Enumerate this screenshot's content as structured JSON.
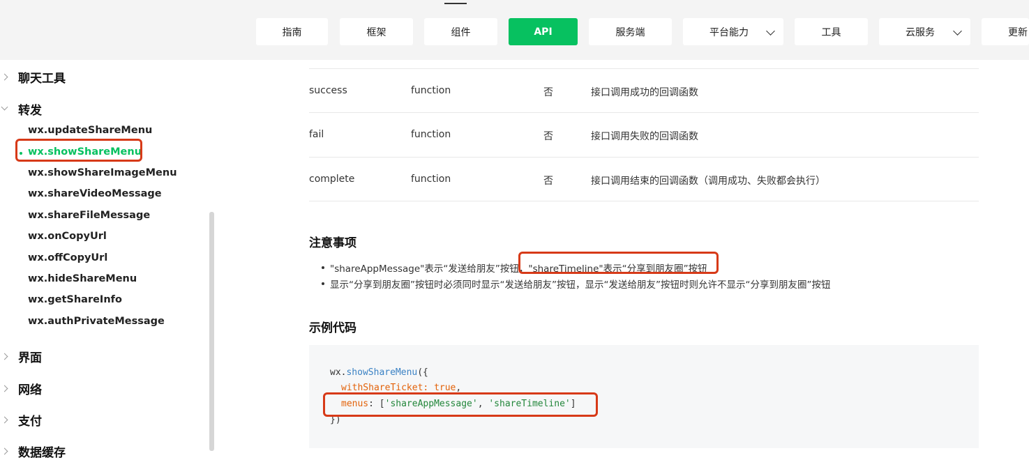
{
  "nav": {
    "tabs": [
      {
        "label": "指南"
      },
      {
        "label": "框架"
      },
      {
        "label": "组件"
      },
      {
        "label": "API"
      },
      {
        "label": "服务端"
      },
      {
        "label": "平台能力"
      },
      {
        "label": "工具"
      },
      {
        "label": "云服务"
      },
      {
        "label": "更新"
      }
    ],
    "active_color": "#07c160"
  },
  "sidebar": {
    "categories": [
      {
        "label": "聊天工具"
      },
      {
        "label": "转发"
      },
      {
        "label": "界面"
      },
      {
        "label": "网络"
      },
      {
        "label": "支付"
      },
      {
        "label": "数据缓存"
      }
    ],
    "items": [
      {
        "label": "wx.updateShareMenu"
      },
      {
        "label": "wx.showShareMenu"
      },
      {
        "label": "wx.showShareImageMenu"
      },
      {
        "label": "wx.shareVideoMessage"
      },
      {
        "label": "wx.shareFileMessage"
      },
      {
        "label": "wx.onCopyUrl"
      },
      {
        "label": "wx.offCopyUrl"
      },
      {
        "label": "wx.hideShareMenu"
      },
      {
        "label": "wx.getShareInfo"
      },
      {
        "label": "wx.authPrivateMessage"
      }
    ]
  },
  "params_table": {
    "rows": [
      {
        "name": "success",
        "type": "function",
        "required": "否",
        "desc": "接口调用成功的回调函数"
      },
      {
        "name": "fail",
        "type": "function",
        "required": "否",
        "desc": "接口调用失败的回调函数"
      },
      {
        "name": "complete",
        "type": "function",
        "required": "否",
        "desc": "接口调用结束的回调函数（调用成功、失败都会执行）"
      }
    ]
  },
  "notes": {
    "title": "注意事项",
    "items": [
      {
        "part1": "\"shareAppMessage\"表示“发送给朋友”按钮，",
        "part2": "\"shareTimeline\"表示“分享到朋友圈”按钮"
      },
      {
        "part1": "显示“分享到朋友圈”按钮时必须同时显示“发送给朋友”按钮，显示“发送给朋友”按钮时则允许不显示“分享到朋友圈”按钮",
        "part2": ""
      }
    ]
  },
  "example": {
    "title": "示例代码",
    "code": {
      "l1_obj": "wx.",
      "l1_fn": "showShareMenu",
      "l1_rest": "({",
      "l2_key": "withShareTicket",
      "l2_colon": ": ",
      "l2_val": "true",
      "l2_comma": ",",
      "l3_key": "menus",
      "l3_colon": ": [",
      "l3_s1": "'shareAppMessage'",
      "l3_sep": ", ",
      "l3_s2": "'shareTimeline'",
      "l3_end": "]",
      "l4": "})"
    }
  },
  "highlight_color": "#d73a18"
}
